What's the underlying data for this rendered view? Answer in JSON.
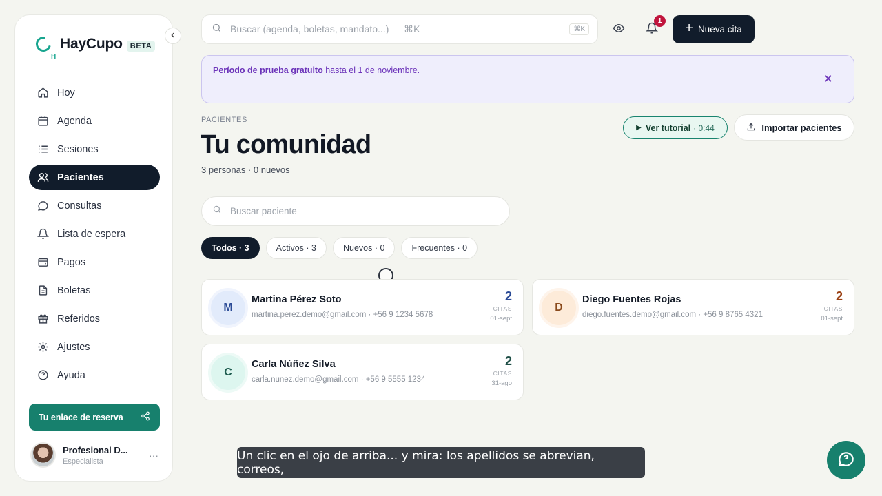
{
  "brand": {
    "name": "HayCupo",
    "badge": "BETA"
  },
  "sidebar": {
    "items": [
      {
        "label": "Hoy",
        "icon": "home-icon",
        "active": false
      },
      {
        "label": "Agenda",
        "icon": "calendar-icon",
        "active": false
      },
      {
        "label": "Sesiones",
        "icon": "list-icon",
        "active": false
      },
      {
        "label": "Pacientes",
        "icon": "users-icon",
        "active": true
      },
      {
        "label": "Consultas",
        "icon": "chat-icon",
        "active": false
      },
      {
        "label": "Lista de espera",
        "icon": "bell-icon",
        "active": false
      },
      {
        "label": "Pagos",
        "icon": "wallet-icon",
        "active": false
      },
      {
        "label": "Boletas",
        "icon": "document-icon",
        "active": false
      },
      {
        "label": "Referidos",
        "icon": "gift-icon",
        "active": false
      },
      {
        "label": "Ajustes",
        "icon": "gear-icon",
        "active": false
      },
      {
        "label": "Ayuda",
        "icon": "help-icon",
        "active": false
      }
    ],
    "booking_link": "Tu enlace de reserva",
    "profile": {
      "name": "Profesional D...",
      "role": "Especialista"
    }
  },
  "topbar": {
    "search_placeholder": "Buscar (agenda, boletas, mandato...) — ⌘K",
    "search_kbd": "⌘K",
    "notifications": "1",
    "new_button": "Nueva cita"
  },
  "banner": {
    "bold": "Período de prueba gratuito",
    "rest": " hasta el 1 de noviembre."
  },
  "page": {
    "eyebrow": "PACIENTES",
    "title": "Tu comunidad",
    "subtitle": "3 personas · 0 nuevos",
    "tutorial_label": "Ver tutorial",
    "tutorial_duration": "· 0:44",
    "import_label": "Importar pacientes",
    "search_placeholder": "Buscar paciente"
  },
  "filters": [
    {
      "label": "Todos · 3",
      "active": true
    },
    {
      "label": "Activos · 3",
      "active": false
    },
    {
      "label": "Nuevos · 0",
      "active": false
    },
    {
      "label": "Frecuentes · 0",
      "active": false
    }
  ],
  "patients": [
    {
      "initial": "M",
      "name": "Martina Pérez Soto",
      "meta": "martina.perez.demo@gmail.com · +56 9 1234 5678",
      "count": "2",
      "count_label": "CITAS",
      "date": "01-sept",
      "avatar_bg": "#e2ebfb",
      "avatar_fg": "#2a4a96",
      "count_color": "#2a4a96"
    },
    {
      "initial": "D",
      "name": "Diego Fuentes Rojas",
      "meta": "diego.fuentes.demo@gmail.com · +56 9 8765 4321",
      "count": "2",
      "count_label": "CITAS",
      "date": "01-sept",
      "avatar_bg": "#fdebd9",
      "avatar_fg": "#8a4a1c",
      "count_color": "#9a3f12"
    },
    {
      "initial": "C",
      "name": "Carla Núñez Silva",
      "meta": "carla.nunez.demo@gmail.com · +56 9 5555 1234",
      "count": "2",
      "count_label": "CITAS",
      "date": "31-ago",
      "avatar_bg": "#ddf6ef",
      "avatar_fg": "#1f5d50",
      "count_color": "#1f4f47"
    }
  ],
  "caption": "Un clic en el ojo de arriba... y mira: los apellidos se abrevian, correos,"
}
